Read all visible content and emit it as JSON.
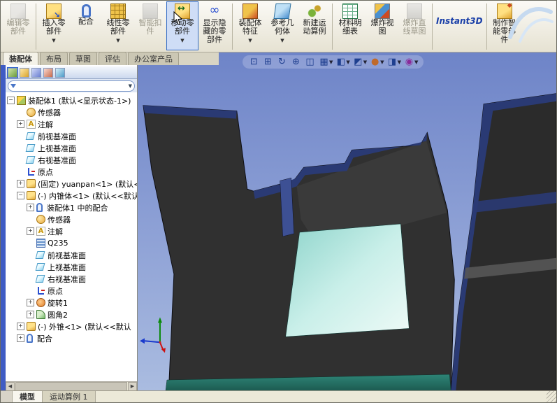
{
  "toolbar": {
    "dropdown_glyph": "▼",
    "separators_after": [
      0,
      6,
      9,
      12,
      13
    ],
    "buttons": [
      {
        "name": "edit-component",
        "icon": "edit-component-icon",
        "lines": [
          "编辑零",
          "部件"
        ],
        "state": "disabled",
        "dropdown": false
      },
      {
        "name": "insert-component",
        "icon": "insert-component-icon",
        "lines": [
          "插入零",
          "部件"
        ],
        "state": "normal",
        "dropdown": true
      },
      {
        "name": "mate",
        "icon": "mate-icon",
        "lines": [
          "配合"
        ],
        "state": "normal",
        "dropdown": false
      },
      {
        "name": "linear-component-pattern",
        "icon": "linear-pattern-icon",
        "lines": [
          "线性零",
          "部件"
        ],
        "state": "normal",
        "dropdown": true
      },
      {
        "name": "smart-fasteners",
        "icon": "smart-fasteners-icon",
        "lines": [
          "智能扣",
          "件"
        ],
        "state": "disabled",
        "dropdown": false
      },
      {
        "name": "move-component",
        "icon": "move-component-icon",
        "lines": [
          "移动零",
          "部件"
        ],
        "state": "selected",
        "dropdown": true
      },
      {
        "name": "show-hidden-components",
        "icon": "show-hidden-icon",
        "lines": [
          "显示隐",
          "藏的零",
          "部件"
        ],
        "state": "normal",
        "dropdown": false
      },
      {
        "name": "assembly-features",
        "icon": "assembly-features-icon",
        "lines": [
          "装配体",
          "特征"
        ],
        "state": "normal",
        "dropdown": true
      },
      {
        "name": "reference-geometry",
        "icon": "reference-geometry-icon",
        "lines": [
          "参考几",
          "何体"
        ],
        "state": "normal",
        "dropdown": true
      },
      {
        "name": "new-motion-study",
        "icon": "motion-study-icon",
        "lines": [
          "新建运",
          "动算例"
        ],
        "state": "normal",
        "dropdown": false
      },
      {
        "name": "bill-of-materials",
        "icon": "bom-icon",
        "lines": [
          "材料明",
          "细表"
        ],
        "state": "normal",
        "dropdown": false
      },
      {
        "name": "exploded-view",
        "icon": "exploded-view-icon",
        "lines": [
          "爆炸视",
          "图"
        ],
        "state": "normal",
        "dropdown": false
      },
      {
        "name": "explode-line-sketch",
        "icon": "explode-line-icon",
        "lines": [
          "爆炸直",
          "线草图"
        ],
        "state": "disabled",
        "dropdown": false
      },
      {
        "name": "instant3d",
        "icon": "instant3d-icon",
        "lines": [
          "Instant3D"
        ],
        "state": "normal",
        "dropdown": false
      },
      {
        "name": "make-smart-component",
        "icon": "smart-component-icon",
        "lines": [
          "制作智",
          "能零部",
          "件"
        ],
        "state": "normal",
        "dropdown": false
      }
    ]
  },
  "command_tabs": {
    "items": [
      {
        "label": "装配体",
        "active": true
      },
      {
        "label": "布局",
        "active": false
      },
      {
        "label": "草图",
        "active": false
      },
      {
        "label": "评估",
        "active": false
      },
      {
        "label": "办公室产品",
        "active": false
      }
    ]
  },
  "hud": {
    "dropdown_glyph": "▼",
    "items": [
      {
        "name": "zoom-fit-icon",
        "glyph": "⊡",
        "dropdown": false
      },
      {
        "name": "zoom-area-icon",
        "glyph": "⊞",
        "dropdown": false
      },
      {
        "name": "rotate-view-icon",
        "glyph": "↻",
        "dropdown": false
      },
      {
        "name": "pan-icon",
        "glyph": "⊕",
        "dropdown": false
      },
      {
        "name": "section-view-icon",
        "glyph": "◫",
        "dropdown": false
      },
      {
        "name": "view-orientation-icon",
        "glyph": "▦",
        "dropdown": true
      },
      {
        "name": "display-style-icon",
        "glyph": "◧",
        "dropdown": true
      },
      {
        "name": "hide-show-items-icon",
        "glyph": "◩",
        "dropdown": true
      },
      {
        "name": "edit-appearance-icon",
        "glyph": "●",
        "dropdown": true
      },
      {
        "name": "apply-scene-icon",
        "glyph": "◨",
        "dropdown": true
      },
      {
        "name": "view-settings-icon",
        "glyph": "◉",
        "dropdown": true
      }
    ]
  },
  "panel": {
    "tabs": [
      {
        "name": "featuremanager-tab-icon",
        "active": true
      },
      {
        "name": "propertymanager-tab-icon",
        "active": false
      },
      {
        "name": "configurationmanager-tab-icon",
        "active": false
      },
      {
        "name": "dimxpertmanager-tab-icon",
        "active": false
      },
      {
        "name": "displaymanager-tab-icon",
        "active": false
      }
    ],
    "filter": {
      "value": "",
      "dropdown_glyph": "▼"
    },
    "expand_glyphs": {
      "plus": "+",
      "minus": "−"
    },
    "scrollbar": {
      "left_glyph": "◀",
      "right_glyph": "▶"
    },
    "tree": [
      {
        "indent": 0,
        "expand": "minus",
        "icon": "assembly-icon",
        "label": "装配体1 (默认<显示状态-1>)"
      },
      {
        "indent": 1,
        "expand": null,
        "icon": "sensors-icon",
        "label": "传感器"
      },
      {
        "indent": 1,
        "expand": "plus",
        "icon": "annotations-icon",
        "label": "注解"
      },
      {
        "indent": 1,
        "expand": null,
        "icon": "plane-icon",
        "label": "前视基准面"
      },
      {
        "indent": 1,
        "expand": null,
        "icon": "plane-icon",
        "label": "上视基准面"
      },
      {
        "indent": 1,
        "expand": null,
        "icon": "plane-icon",
        "label": "右视基准面"
      },
      {
        "indent": 1,
        "expand": null,
        "icon": "origin-icon",
        "label": "原点"
      },
      {
        "indent": 1,
        "expand": "plus",
        "icon": "part-icon",
        "label": "(固定) yuanpan<1> (默认<"
      },
      {
        "indent": 1,
        "expand": "minus",
        "icon": "part-icon",
        "label": "(-) 内锥体<1> (默认<<默认"
      },
      {
        "indent": 2,
        "expand": "plus",
        "icon": "mates-in-assembly-icon",
        "label": "装配体1 中的配合"
      },
      {
        "indent": 2,
        "expand": null,
        "icon": "sensors-icon",
        "label": "传感器"
      },
      {
        "indent": 2,
        "expand": "plus",
        "icon": "annotations-icon",
        "label": "注解"
      },
      {
        "indent": 2,
        "expand": null,
        "icon": "material-icon",
        "label": "Q235"
      },
      {
        "indent": 2,
        "expand": null,
        "icon": "plane-icon",
        "label": "前视基准面"
      },
      {
        "indent": 2,
        "expand": null,
        "icon": "plane-icon",
        "label": "上视基准面"
      },
      {
        "indent": 2,
        "expand": null,
        "icon": "plane-icon",
        "label": "右视基准面"
      },
      {
        "indent": 2,
        "expand": null,
        "icon": "origin-icon",
        "label": "原点"
      },
      {
        "indent": 2,
        "expand": "plus",
        "icon": "revolve-icon",
        "label": "旋转1"
      },
      {
        "indent": 2,
        "expand": "plus",
        "icon": "fillet-icon",
        "label": "圆角2"
      },
      {
        "indent": 1,
        "expand": "plus",
        "icon": "part-icon",
        "label": "(-) 外锥<1> (默认<<默认"
      },
      {
        "indent": 1,
        "expand": "plus",
        "icon": "mates-icon",
        "label": "配合"
      }
    ]
  },
  "status_bar": {
    "tabs": [
      {
        "label": "模型",
        "active": true
      },
      {
        "label": "运动算例 1",
        "active": false
      }
    ]
  },
  "colors": {
    "panel_strip": "#3f5cc4",
    "viewport_top": "#6e84c8",
    "viewport_bottom": "#aabce0",
    "model_dark": "#303030",
    "model_navy": "#2a3a74",
    "model_cyan": "#bfeee8",
    "model_teal": "#2e8577",
    "selected_button_border": "#316ac5"
  }
}
